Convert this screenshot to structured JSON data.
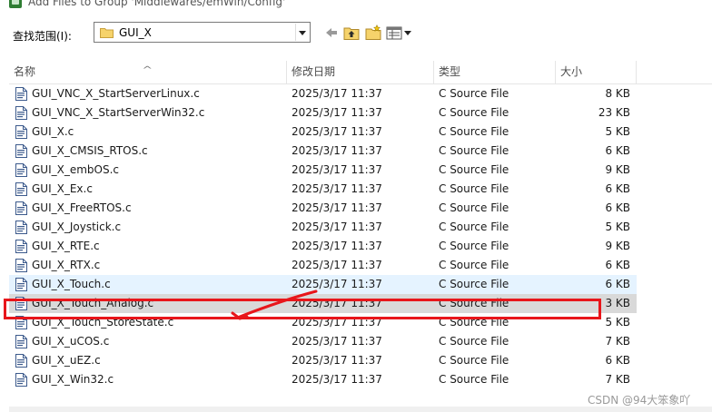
{
  "window": {
    "title": "Add Files to Group 'Middlewares/emWin/Config'"
  },
  "lookin": {
    "label": "查找范围(I):",
    "value": "GUI_X"
  },
  "toolbar": {
    "icons": [
      "back-arrow-icon",
      "up-folder-icon",
      "new-folder-icon",
      "view-menu-icon"
    ]
  },
  "columns": {
    "name": "名称",
    "date": "修改日期",
    "type": "类型",
    "size": "大小"
  },
  "files": [
    {
      "name": "GUI_VNC_X_StartServerLinux.c",
      "date": "2025/3/17 11:37",
      "type": "C Source File",
      "size": "8 KB"
    },
    {
      "name": "GUI_VNC_X_StartServerWin32.c",
      "date": "2025/3/17 11:37",
      "type": "C Source File",
      "size": "23 KB"
    },
    {
      "name": "GUI_X.c",
      "date": "2025/3/17 11:37",
      "type": "C Source File",
      "size": "5 KB"
    },
    {
      "name": "GUI_X_CMSIS_RTOS.c",
      "date": "2025/3/17 11:37",
      "type": "C Source File",
      "size": "6 KB"
    },
    {
      "name": "GUI_X_embOS.c",
      "date": "2025/3/17 11:37",
      "type": "C Source File",
      "size": "9 KB"
    },
    {
      "name": "GUI_X_Ex.c",
      "date": "2025/3/17 11:37",
      "type": "C Source File",
      "size": "6 KB"
    },
    {
      "name": "GUI_X_FreeRTOS.c",
      "date": "2025/3/17 11:37",
      "type": "C Source File",
      "size": "6 KB"
    },
    {
      "name": "GUI_X_Joystick.c",
      "date": "2025/3/17 11:37",
      "type": "C Source File",
      "size": "5 KB"
    },
    {
      "name": "GUI_X_RTE.c",
      "date": "2025/3/17 11:37",
      "type": "C Source File",
      "size": "9 KB"
    },
    {
      "name": "GUI_X_RTX.c",
      "date": "2025/3/17 11:37",
      "type": "C Source File",
      "size": "6 KB"
    },
    {
      "name": "GUI_X_Touch.c",
      "date": "2025/3/17 11:37",
      "type": "C Source File",
      "size": "6 KB"
    },
    {
      "name": "GUI_X_Touch_Analog.c",
      "date": "2025/3/17 11:37",
      "type": "C Source File",
      "size": "3 KB"
    },
    {
      "name": "GUI_X_Touch_StoreState.c",
      "date": "2025/3/17 11:37",
      "type": "C Source File",
      "size": "5 KB"
    },
    {
      "name": "GUI_X_uCOS.c",
      "date": "2025/3/17 11:37",
      "type": "C Source File",
      "size": "7 KB"
    },
    {
      "name": "GUI_X_uEZ.c",
      "date": "2025/3/17 11:37",
      "type": "C Source File",
      "size": "6 KB"
    },
    {
      "name": "GUI_X_Win32.c",
      "date": "2025/3/17 11:37",
      "type": "C Source File",
      "size": "7 KB"
    }
  ],
  "hover_row": 10,
  "selected_row": 11,
  "colors": {
    "hover": "#e5f3ff",
    "selected": "#d9d9d9",
    "annotation": "#e8161b"
  },
  "watermark": "CSDN @94大笨象吖"
}
